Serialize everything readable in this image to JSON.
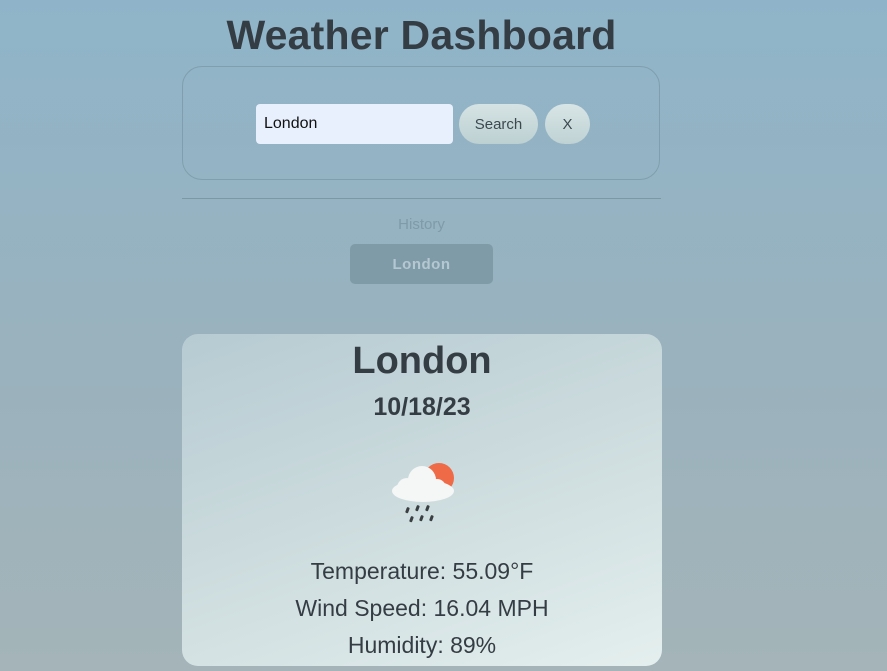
{
  "app": {
    "title": "Weather Dashboard"
  },
  "search": {
    "value": "London",
    "search_label": "Search",
    "clear_label": "X"
  },
  "history": {
    "label": "History",
    "items": [
      {
        "label": "London"
      }
    ]
  },
  "weather": {
    "city": "London",
    "date": "10/18/23",
    "icon": "rain-cloud-sun-icon",
    "temperature": "Temperature: 55.09°F",
    "wind": "Wind Speed: 16.04 MPH",
    "humidity": "Humidity: 89%"
  },
  "colors": {
    "background_top": "#8fb4c9",
    "background_bottom": "#a4b4b8",
    "input_bg": "#e8f0fe",
    "history_button_bg": "#809ba8",
    "sun": "#ef6b47"
  }
}
